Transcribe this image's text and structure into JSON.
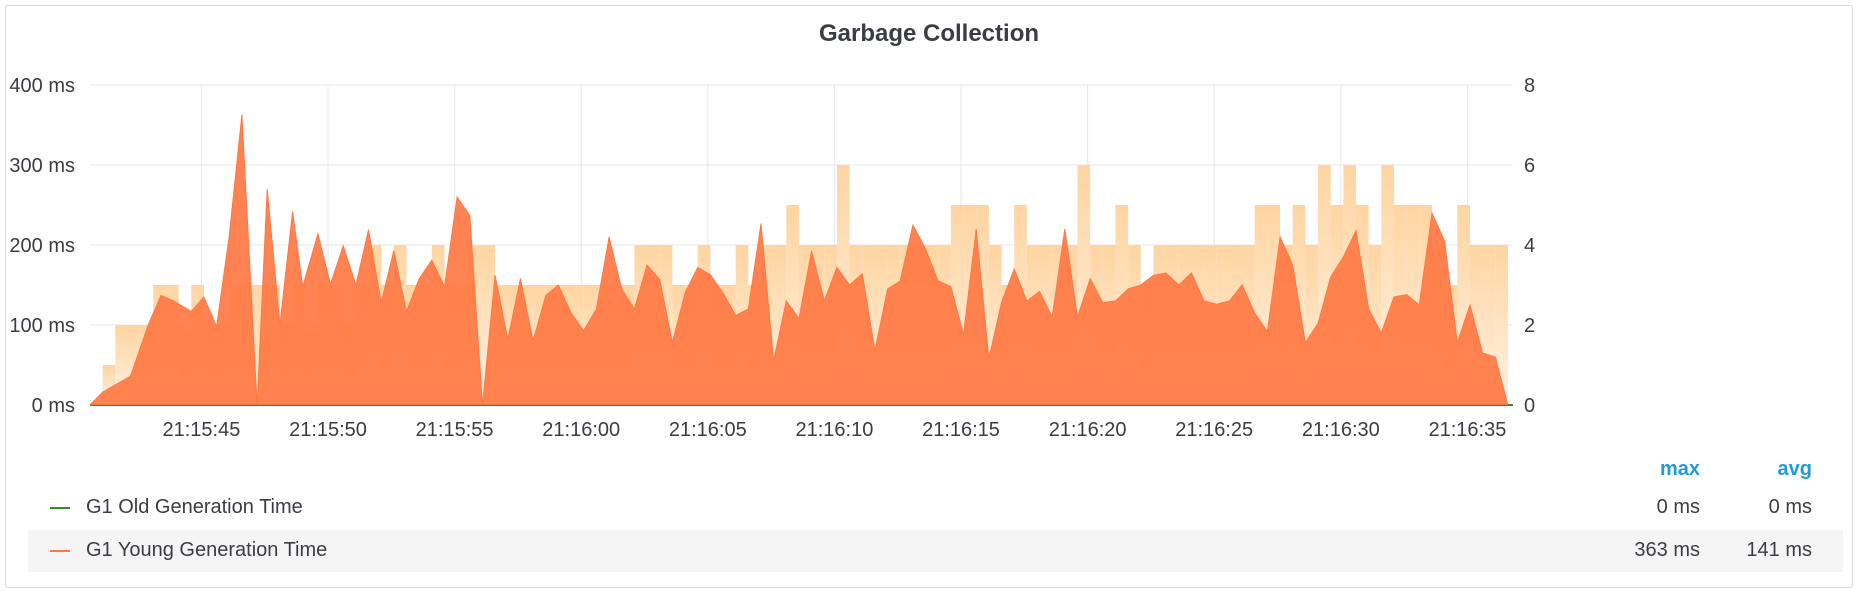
{
  "panel": {
    "title": "Garbage Collection"
  },
  "chart_data": {
    "type": "area",
    "title": "Garbage Collection",
    "x_tick_labels": [
      "21:15:45",
      "21:15:50",
      "21:15:55",
      "21:16:00",
      "21:16:05",
      "21:16:10",
      "21:16:15",
      "21:16:20",
      "21:16:25",
      "21:16:30",
      "21:16:35"
    ],
    "x_tick_seconds": [
      45,
      50,
      55,
      60,
      65,
      70,
      75,
      80,
      85,
      90,
      95
    ],
    "x_range_seconds": [
      40.6,
      96.8
    ],
    "y_left": {
      "ticks": [
        "0 ms",
        "100 ms",
        "200 ms",
        "300 ms",
        "400 ms"
      ],
      "values": [
        0,
        100,
        200,
        300,
        400
      ],
      "range": [
        0,
        400
      ]
    },
    "y_right": {
      "ticks": [
        "0",
        "2",
        "4",
        "6",
        "8"
      ],
      "values": [
        0,
        2,
        4,
        6,
        8
      ],
      "range": [
        0,
        8
      ]
    },
    "grid": true,
    "series": [
      {
        "name": "G1 Old Generation Time",
        "color": "#37872d",
        "axis": "left",
        "x_seconds": [
          40.6,
          96.8
        ],
        "values": [
          0,
          0
        ]
      },
      {
        "name": "G1 Young Generation Time",
        "color": "#ff7843",
        "axis": "left",
        "x_seconds": [
          40.6,
          41.1,
          42.2,
          42.9,
          43.4,
          43.9,
          44.6,
          45.1,
          45.6,
          46.1,
          46.6,
          47.2,
          47.6,
          48.1,
          48.6,
          49.0,
          49.6,
          50.1,
          50.6,
          51.1,
          51.6,
          52.1,
          52.6,
          53.1,
          53.6,
          54.1,
          54.6,
          55.1,
          55.6,
          56.1,
          56.6,
          57.1,
          57.6,
          58.1,
          58.6,
          59.1,
          59.6,
          60.1,
          60.6,
          61.1,
          61.6,
          62.1,
          62.6,
          63.1,
          63.6,
          64.1,
          64.6,
          65.1,
          65.6,
          66.1,
          66.6,
          67.1,
          67.6,
          68.1,
          68.6,
          69.1,
          69.6,
          70.1,
          70.6,
          71.1,
          71.6,
          72.1,
          72.6,
          73.1,
          73.6,
          74.1,
          74.6,
          75.1,
          75.6,
          76.1,
          76.6,
          77.1,
          77.6,
          78.1,
          78.6,
          79.1,
          79.6,
          80.1,
          80.6,
          81.1,
          81.6,
          82.1,
          82.6,
          83.1,
          83.6,
          84.1,
          84.6,
          85.1,
          85.6,
          86.1,
          86.6,
          87.1,
          87.6,
          88.1,
          88.6,
          89.1,
          89.6,
          90.1,
          90.6,
          91.1,
          91.6,
          92.1,
          92.6,
          93.1,
          93.6,
          94.1,
          94.6,
          95.1,
          95.6,
          96.1,
          96.6,
          96.8
        ],
        "values": [
          0,
          16,
          36,
          100,
          137,
          130,
          117,
          135,
          98,
          212,
          363,
          0,
          270,
          100,
          242,
          148,
          214,
          151,
          199,
          150,
          219,
          128,
          193,
          117,
          158,
          181,
          148,
          260,
          237,
          0,
          162,
          82,
          158,
          80,
          137,
          150,
          115,
          93,
          120,
          210,
          145,
          120,
          175,
          157,
          78,
          140,
          172,
          163,
          140,
          112,
          120,
          227,
          55,
          130,
          108,
          193,
          130,
          172,
          150,
          164,
          68,
          145,
          155,
          225,
          195,
          155,
          148,
          88,
          220,
          58,
          128,
          170,
          130,
          142,
          110,
          220,
          110,
          158,
          128,
          130,
          145,
          150,
          162,
          165,
          150,
          165,
          130,
          126,
          130,
          150,
          115,
          92,
          210,
          175,
          78,
          102,
          160,
          185,
          218,
          120,
          90,
          135,
          138,
          125,
          240,
          205,
          78,
          125,
          65,
          60,
          0
        ]
      }
    ],
    "band_series_right_axis": {
      "description_visible": false,
      "x_seconds_bins_start": [
        41.1,
        41.6,
        42.1,
        42.6,
        43.1,
        43.6,
        44.1,
        44.6,
        45.1,
        45.6,
        46.1,
        46.6,
        47.1,
        47.6,
        48.1,
        48.6,
        49.1,
        49.6,
        50.1,
        50.6,
        51.1,
        51.6,
        52.1,
        52.6,
        53.1,
        53.6,
        54.1,
        54.6,
        55.1,
        55.6,
        56.1,
        56.6,
        57.1,
        57.6,
        58.1,
        58.6,
        59.1,
        59.6,
        60.1,
        60.6,
        61.1,
        61.6,
        62.1,
        62.6,
        63.1,
        63.6,
        64.1,
        64.6,
        65.1,
        65.6,
        66.1,
        66.6,
        67.1,
        67.6,
        68.1,
        68.6,
        69.1,
        69.6,
        70.1,
        70.6,
        71.1,
        71.6,
        72.1,
        72.6,
        73.1,
        73.6,
        74.1,
        74.6,
        75.1,
        75.6,
        76.1,
        76.6,
        77.1,
        77.6,
        78.1,
        78.6,
        79.1,
        79.6,
        80.1,
        80.6,
        81.1,
        81.6,
        82.1,
        82.6,
        83.1,
        83.6,
        84.1,
        84.6,
        85.1,
        85.6,
        86.1,
        86.6,
        87.1,
        87.6,
        88.1,
        88.6,
        89.1,
        89.6,
        90.1,
        90.6,
        91.1,
        91.6,
        92.1,
        92.6,
        93.1,
        93.6,
        94.1,
        94.6,
        95.1,
        95.6,
        96.1
      ],
      "values": [
        1,
        2,
        2,
        2,
        3,
        3,
        2,
        3,
        2,
        2,
        3,
        3,
        3,
        3,
        2,
        3,
        2,
        3,
        3,
        2,
        3,
        4,
        3,
        4,
        3,
        3,
        4,
        3,
        3,
        4,
        4,
        3,
        3,
        3,
        3,
        3,
        3,
        3,
        3,
        3,
        3,
        3,
        4,
        4,
        4,
        3,
        3,
        4,
        3,
        3,
        4,
        3,
        4,
        4,
        5,
        4,
        4,
        4,
        6,
        4,
        4,
        4,
        4,
        4,
        4,
        4,
        4,
        5,
        5,
        5,
        4,
        3,
        5,
        4,
        4,
        4,
        4,
        6,
        4,
        4,
        5,
        4,
        3,
        4,
        4,
        4,
        4,
        4,
        4,
        4,
        4,
        5,
        5,
        4,
        5,
        4,
        6,
        5,
        6,
        5,
        4,
        6,
        5,
        5,
        5,
        4,
        3,
        5,
        4,
        4,
        4,
        4,
        3
      ]
    }
  },
  "legend": {
    "headers": {
      "max": "max",
      "avg": "avg"
    },
    "rows": [
      {
        "name": "G1 Old Generation Time",
        "color": "#37872d",
        "max": "0 ms",
        "avg": "0 ms"
      },
      {
        "name": "G1 Young Generation Time",
        "color": "#ff7843",
        "max": "363 ms",
        "avg": "141 ms"
      }
    ]
  }
}
